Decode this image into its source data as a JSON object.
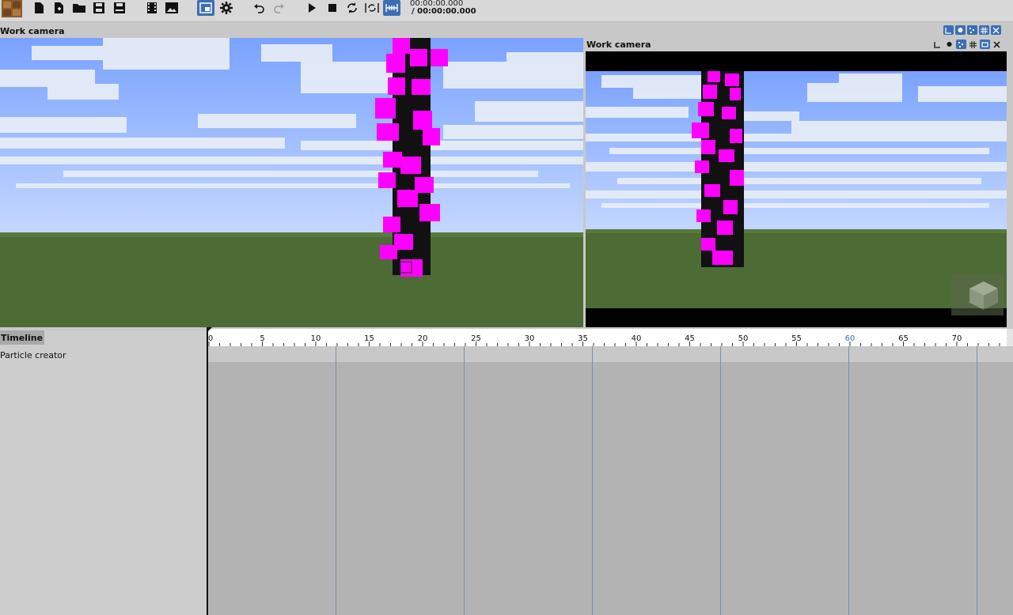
{
  "toolbar": {
    "buttons": [
      {
        "name": "new-file-icon"
      },
      {
        "name": "new-file-plus-icon"
      },
      {
        "name": "open-folder-icon"
      },
      {
        "name": "save-icon"
      },
      {
        "name": "save-as-icon"
      },
      {
        "name": "render-movie-icon"
      },
      {
        "name": "render-image-icon"
      },
      {
        "name": "viewport-layout-icon",
        "active": true
      },
      {
        "name": "settings-gear-icon"
      },
      {
        "name": "undo-icon"
      },
      {
        "name": "redo-icon"
      },
      {
        "name": "play-icon"
      },
      {
        "name": "stop-icon"
      },
      {
        "name": "loop-icon"
      },
      {
        "name": "loop-range-icon"
      },
      {
        "name": "timeline-markers-icon",
        "active": true
      }
    ],
    "time_current": "00:00:00.000",
    "time_total": "/ 00:00:00.000"
  },
  "viewports": {
    "left_title": "Work camera",
    "right_title": "Work camera"
  },
  "timeline": {
    "title": "Timeline",
    "tracks": [
      "Particle creator"
    ],
    "ruler_labels": [
      "0",
      "5",
      "10",
      "15",
      "20",
      "25",
      "30",
      "35",
      "40",
      "45",
      "50",
      "55",
      "60",
      "65",
      "70"
    ],
    "highlight_label": "60",
    "accent_color": "#3b6fb3"
  },
  "colors": {
    "accent": "#3b6fb3",
    "particle_pink": "#ff00ff",
    "grass": "#4d6b34",
    "sky_top": "#7aa2ff",
    "sky_bottom": "#c3d7ff"
  }
}
